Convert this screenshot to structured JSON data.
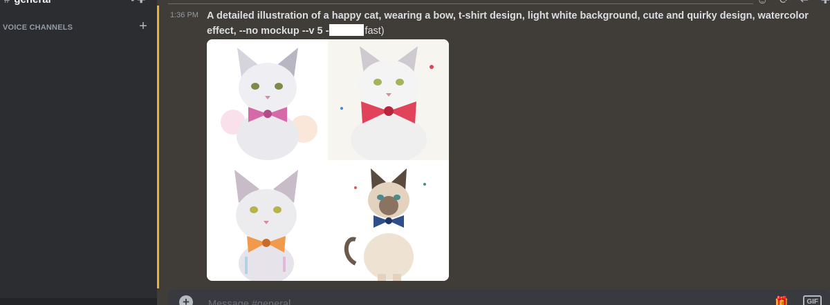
{
  "sidebar": {
    "current_channel": "general",
    "section_title": "VOICE CHANNELS",
    "add_channel_symbol": "+"
  },
  "message": {
    "timestamp": "1:36 PM",
    "prompt_text": "A detailed illustration of a happy cat, wearing a bow, t-shirt design, light white background, cute and quirky design, watercolor effect, --no mockup --v 5 -",
    "suffix_text": "fast)",
    "images": [
      {
        "icon": "cat-with-pink-bow",
        "bow_color": "#d66aa8"
      },
      {
        "icon": "cat-with-red-bow",
        "bow_color": "#e0435a"
      },
      {
        "icon": "cat-with-orange-bow",
        "bow_color": "#f29a4c"
      },
      {
        "icon": "cat-with-blue-bow",
        "bow_color": "#2f4f8a"
      }
    ]
  },
  "composer": {
    "placeholder": "Message #general",
    "gif_label": "GIF"
  },
  "colors": {
    "highlight": "#f0b232",
    "divider": "#c74359",
    "main_bg": "#403c38",
    "sidebar_bg": "#2b2d31"
  }
}
